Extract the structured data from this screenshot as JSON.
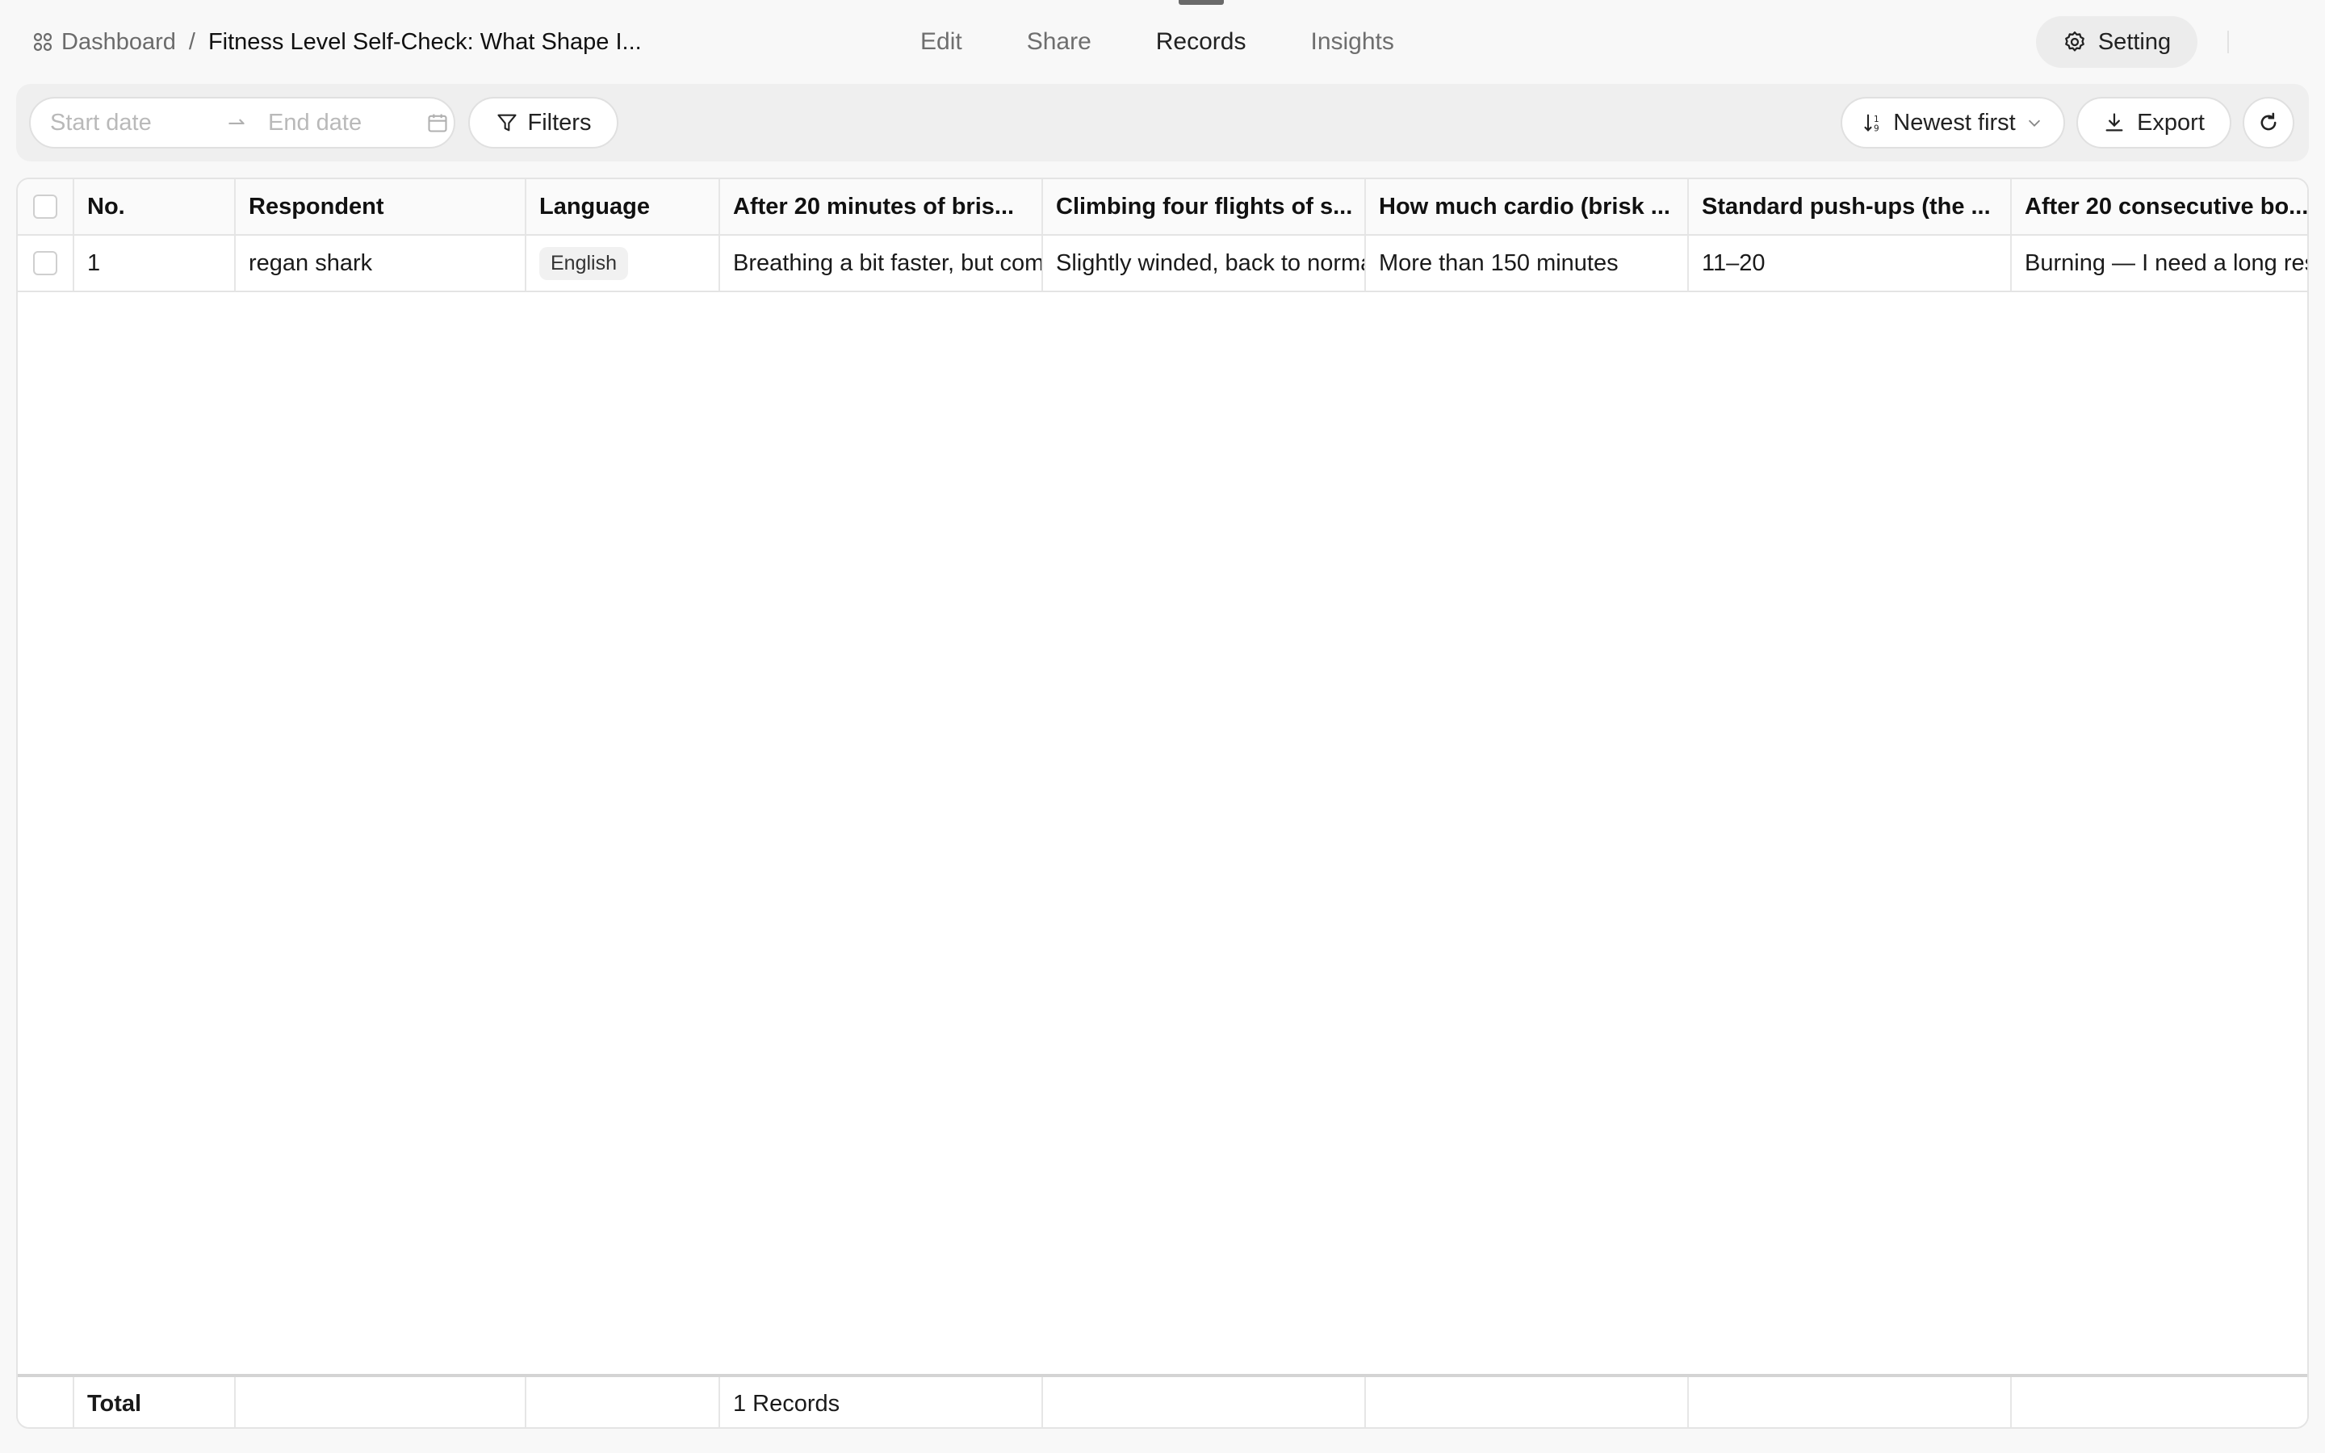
{
  "breadcrumb": {
    "home_label": "Dashboard",
    "separator": "/",
    "current": "Fitness Level Self-Check: What Shape I..."
  },
  "nav": {
    "tabs": [
      {
        "label": "Edit",
        "active": false
      },
      {
        "label": "Share",
        "active": false
      },
      {
        "label": "Records",
        "active": true
      },
      {
        "label": "Insights",
        "active": false
      }
    ]
  },
  "header": {
    "setting_label": "Setting"
  },
  "toolbar": {
    "start_placeholder": "Start date",
    "end_placeholder": "End date",
    "range_arrow": "⇀",
    "filters_label": "Filters",
    "sort_label": "Newest first",
    "export_label": "Export"
  },
  "table": {
    "columns": [
      "No.",
      "Respondent",
      "Language",
      "After 20 minutes of bris...",
      "Climbing four flights of s...",
      "How much cardio (brisk ...",
      "Standard push-ups (the ...",
      "After 20 consecutive bo..."
    ],
    "rows": [
      [
        "1",
        "regan shark",
        "English",
        "Breathing a bit faster, but comfortable",
        "Slightly winded, back to normal quickly",
        "More than 150 minutes",
        "11–20",
        "Burning — I need a long rest"
      ]
    ],
    "total_label": "Total",
    "total_count": "1 Records"
  },
  "colors": {
    "background": "#f8f8f8",
    "toolbar": "#efefef",
    "border": "#e4e4e4",
    "text": "#1a1a1a",
    "muted": "#6b6b6b"
  }
}
